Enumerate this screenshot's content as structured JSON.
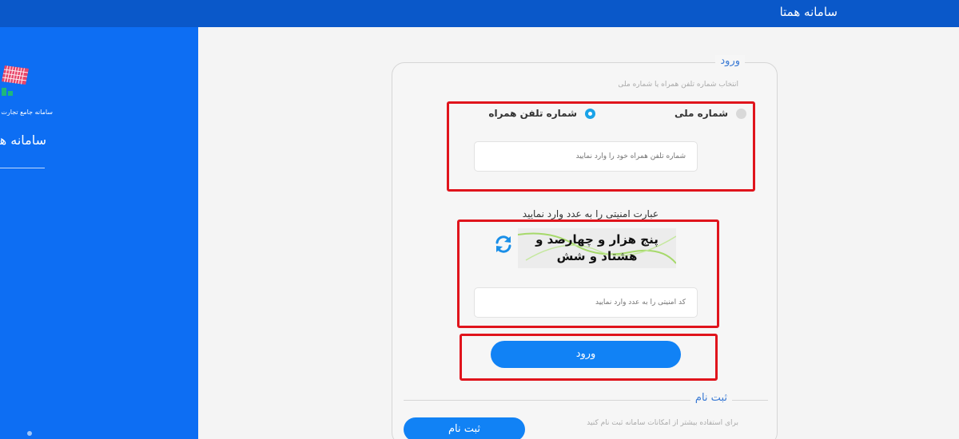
{
  "header": {
    "title": "سامانه همتا"
  },
  "sidebar": {
    "logo_caption": "سامانه جامع تجارت",
    "title": "سامانه همتا"
  },
  "login": {
    "legend": "ورود",
    "subtitle": "انتخاب شماره تلفن همراه یا شماره ملی",
    "options": [
      {
        "label": "شماره ملی",
        "selected": false
      },
      {
        "label": "شماره تلفن همراه",
        "selected": true
      }
    ],
    "phone_placeholder": "شماره تلفن همراه خود را وارد نمایید",
    "captcha_label": "عبارت امنیتی را به عدد وارد نمایید",
    "captcha_text_line1": "پنج هزار و چهارصد و",
    "captcha_text_line2": "هشتاد و شش",
    "captcha_placeholder": "کد امنیتی را به عدد وارد نمایید",
    "submit_label": "ورود"
  },
  "register": {
    "legend": "ثبت نام",
    "description": "برای استفاده بیشتر از امکانات سامانه ثبت نام کنید",
    "button_label": "ثبت نام"
  },
  "colors": {
    "header": "#0a58c9",
    "sidebar": "#0d6ef3",
    "accent": "#1182f5",
    "highlight": "#e0141c"
  }
}
